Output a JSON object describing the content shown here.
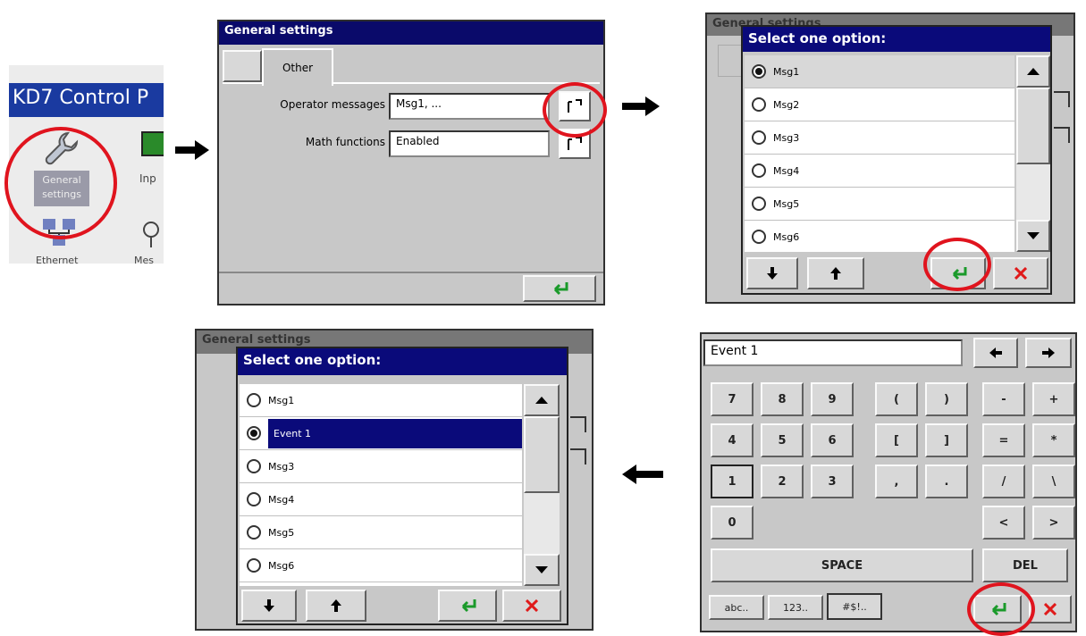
{
  "panel1": {
    "header": "KD7 Control P",
    "icons": [
      {
        "label": "General settings",
        "icon": "wrench-icon"
      },
      {
        "label": "Inp",
        "icon": "input-chart-icon"
      },
      {
        "label": "Ethernet",
        "icon": "ethernet-icon"
      },
      {
        "label": "Mes",
        "icon": "message-icon"
      }
    ]
  },
  "panel2": {
    "title": "General settings",
    "tabs": [
      "",
      "Other"
    ],
    "rows": [
      {
        "label": "Operator messages",
        "value": "Msg1, ..."
      },
      {
        "label": "Math functions",
        "value": "Enabled"
      }
    ],
    "ok_icon": "enter-icon"
  },
  "panel3": {
    "bg_title": "General settings",
    "dialog_title": "Select one option:",
    "options": [
      "Msg1",
      "Msg2",
      "Msg3",
      "Msg4",
      "Msg5",
      "Msg6"
    ],
    "selected_index": 0
  },
  "panel4": {
    "bg_title": "General settings",
    "dialog_title": "Select one option:",
    "options": [
      "Msg1",
      "Event 1",
      "Msg3",
      "Msg4",
      "Msg5",
      "Msg6"
    ],
    "selected_index": 1
  },
  "panel5": {
    "input_value": "Event 1",
    "keys_row1": [
      "7",
      "8",
      "9",
      "(",
      ")",
      "-",
      "+"
    ],
    "keys_row2": [
      "4",
      "5",
      "6",
      "[",
      "]",
      "=",
      "*"
    ],
    "keys_row3": [
      "1",
      "2",
      "3",
      ",",
      ".",
      "/",
      "\\"
    ],
    "keys_row4": [
      "0",
      "<",
      ">"
    ],
    "space_label": "SPACE",
    "del_label": "DEL",
    "mode_tabs": [
      "abc..",
      "123..",
      "#$!.."
    ]
  },
  "colors": {
    "title_bar": "#0a0a6a",
    "highlight_ring": "#e0141e",
    "enter_green": "#1a9a2a",
    "cancel_red": "#e01a1a"
  }
}
